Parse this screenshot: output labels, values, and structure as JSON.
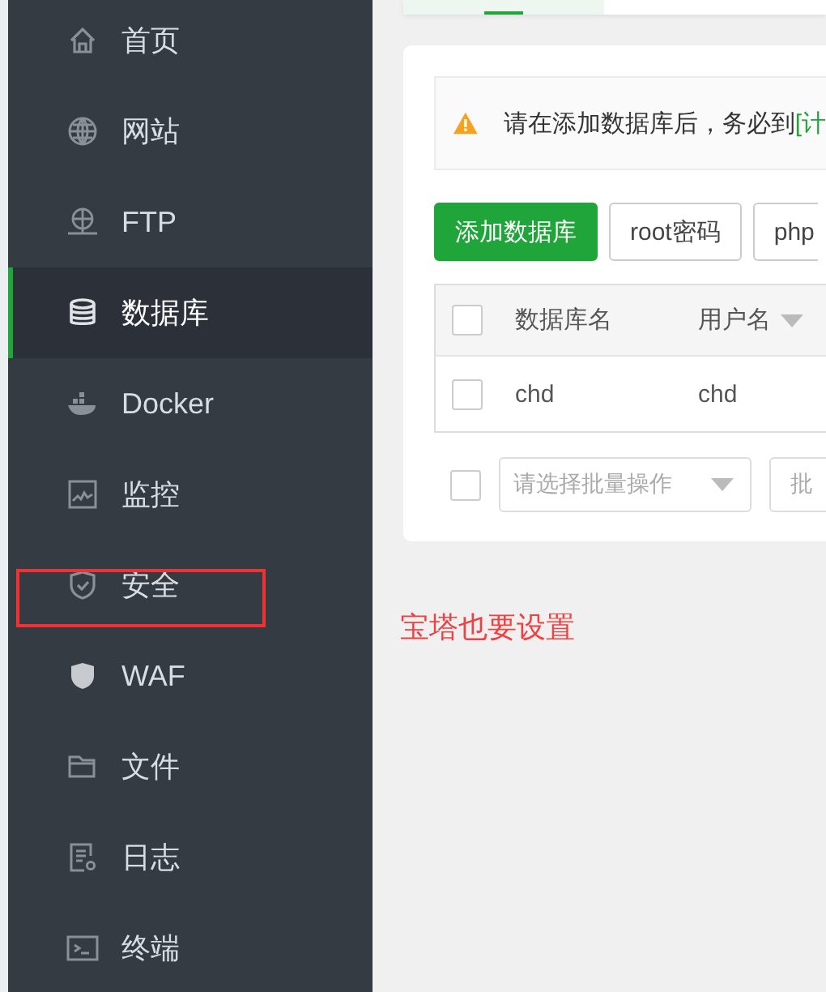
{
  "sidebar": {
    "items": [
      {
        "label": "首页",
        "selected": false,
        "highlighted": false
      },
      {
        "label": "网站",
        "selected": false,
        "highlighted": false
      },
      {
        "label": "FTP",
        "selected": false,
        "highlighted": false
      },
      {
        "label": "数据库",
        "selected": true,
        "highlighted": false
      },
      {
        "label": "Docker",
        "selected": false,
        "highlighted": false
      },
      {
        "label": "监控",
        "selected": false,
        "highlighted": false
      },
      {
        "label": "安全",
        "selected": false,
        "highlighted": true
      },
      {
        "label": "WAF",
        "selected": false,
        "highlighted": false
      },
      {
        "label": "文件",
        "selected": false,
        "highlighted": false
      },
      {
        "label": "日志",
        "selected": false,
        "highlighted": false
      },
      {
        "label": "终端",
        "selected": false,
        "highlighted": false
      }
    ]
  },
  "annotation": {
    "note": "宝塔也要设置"
  },
  "alert": {
    "text": "请在添加数据库后，务必到",
    "link": "[计"
  },
  "buttons": [
    {
      "label": "添加数据库",
      "kind": "primary"
    },
    {
      "label": "root密码",
      "kind": "default"
    },
    {
      "label": "php",
      "kind": "default"
    }
  ],
  "table": {
    "columns": [
      {
        "label": "数据库名",
        "sortable": false
      },
      {
        "label": "用户名",
        "sortable": true
      }
    ],
    "rows": [
      {
        "checked": false,
        "cells": [
          "chd",
          "chd"
        ]
      }
    ]
  },
  "header_checked": false,
  "footer": {
    "checked": false,
    "select_placeholder": "请选择批量操作",
    "field_text": "批"
  }
}
